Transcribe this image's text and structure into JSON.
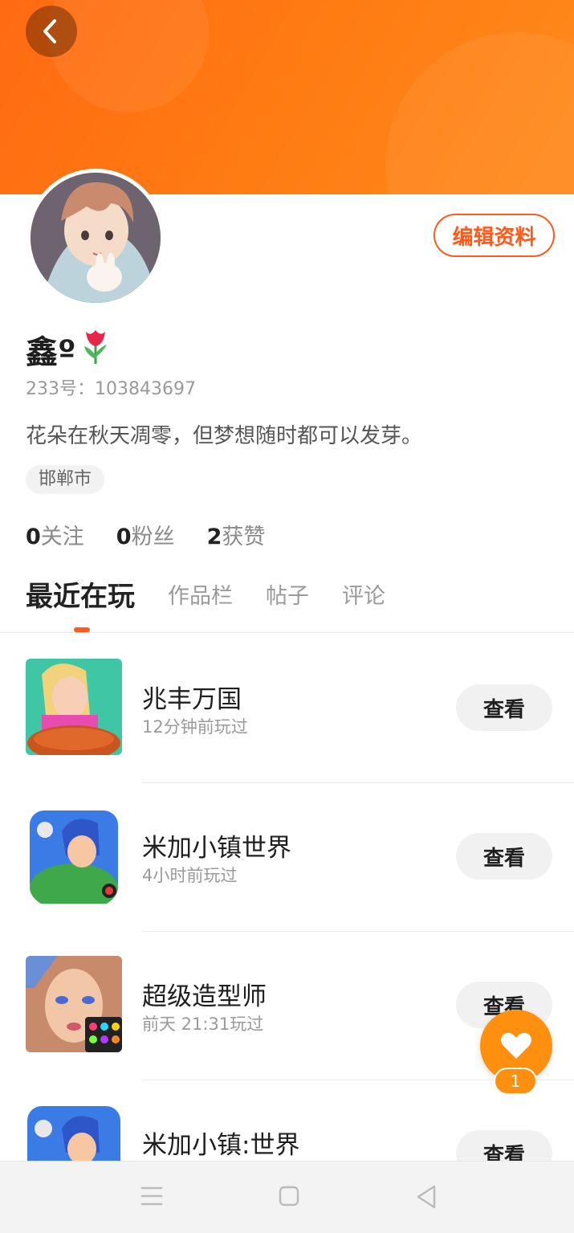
{
  "header": {
    "back_icon": "chevron-left-icon",
    "banner_color": "#ff7a12",
    "edit_profile_label": "编辑资料"
  },
  "profile": {
    "name": "鑫º",
    "name_emoji": "tulip-icon",
    "id_label": "233号：103843697",
    "bio": "花朵在秋天凋零，但梦想随时都可以发芽。",
    "location": "邯郸市",
    "stats": [
      {
        "count": "0",
        "label": "关注"
      },
      {
        "count": "0",
        "label": "粉丝"
      },
      {
        "count": "2",
        "label": "获赞"
      }
    ]
  },
  "tabs": [
    {
      "label": "最近在玩",
      "active": true
    },
    {
      "label": "作品栏",
      "active": false
    },
    {
      "label": "帖子",
      "active": false
    },
    {
      "label": "评论",
      "active": false
    }
  ],
  "games": [
    {
      "title": "兆丰万国",
      "played": "12分钟前玩过",
      "button": "查看"
    },
    {
      "title": "米加小镇世界",
      "played": "4小时前玩过",
      "button": "查看"
    },
    {
      "title": "超级造型师",
      "played": "前天  21:31玩过",
      "button": "查看"
    },
    {
      "title": "米加小镇:世界",
      "played": "",
      "button": "查看"
    }
  ],
  "floating": {
    "like_icon": "heart-icon",
    "like_count": "1",
    "accent": "#ff8f0f"
  },
  "system_nav": {
    "icons": [
      "menu-icon",
      "home-square-icon",
      "back-triangle-icon"
    ]
  }
}
